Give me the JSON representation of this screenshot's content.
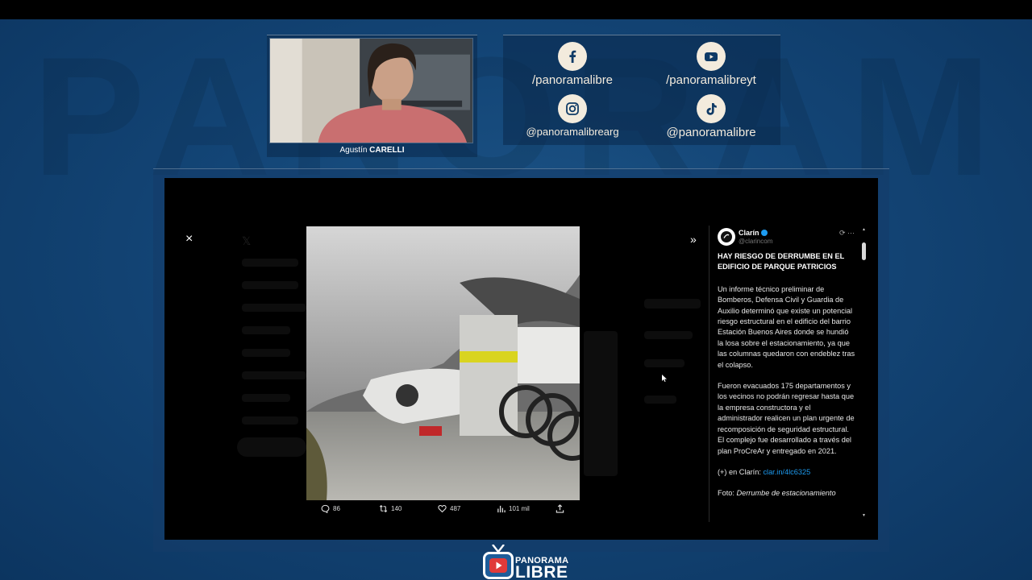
{
  "background_watermark": "PANORAMA",
  "presenter": {
    "first_name": "Agustín",
    "last_name": "CARELLI"
  },
  "social": {
    "facebook": "/panoramalibre",
    "youtube": "/panoramalibreyt",
    "instagram": "@panoramalibrearg",
    "tiktok": "@panoramalibre"
  },
  "viewer": {
    "close_icon": "×",
    "expand_icon": "»",
    "actions": {
      "replies": "86",
      "reposts": "140",
      "likes": "487",
      "views": "101 mil"
    }
  },
  "tweet": {
    "author": "Clarín",
    "handle": "@clarincom",
    "title": "HAY RIESGO DE DERRUMBE EN EL EDIFICIO DE PARQUE PATRICIOS",
    "paragraph_1": "Un informe técnico preliminar de Bomberos, Defensa Civil y Guardia de Auxilio determinó que existe un potencial riesgo estructural en el edificio del barrio Estación Buenos Aires donde se hundió la losa sobre el estacionamiento, ya que las columnas quedaron con endeblez tras el colapso.",
    "paragraph_2": "Fueron evacuados 175 departamentos y los vecinos no podrán regresar hasta que la empresa constructora y el administrador realicen un plan urgente de recomposición de seguridad estructural. El complejo fue desarrollado a través del plan ProCreAr y entregado en 2021.",
    "link_prefix": "(+) en Clarín:",
    "link": "clar.in/4lc6325",
    "foto_prefix": "Foto:",
    "foto_caption": "Derrumbe de estacionamiento"
  },
  "logo": {
    "top": "PANORAMA",
    "bottom": "LIBRE"
  },
  "colors": {
    "accent_blue": "#1d9bf0",
    "cream": "#f3ebdd",
    "background": "#134576"
  }
}
